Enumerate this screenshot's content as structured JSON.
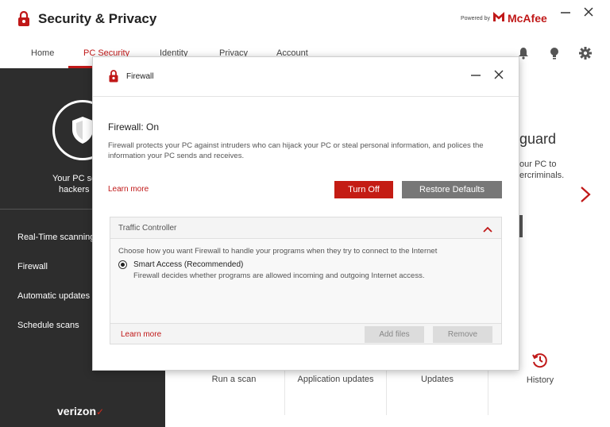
{
  "app": {
    "title": "Security & Privacy"
  },
  "branding": {
    "powered_by": "Powered by",
    "brand": "McAfee"
  },
  "nav": {
    "tabs": [
      {
        "label": "Home"
      },
      {
        "label": "PC Security"
      },
      {
        "label": "Identity"
      },
      {
        "label": "Privacy"
      },
      {
        "label": "Account"
      }
    ],
    "active_tab": "PC Security"
  },
  "sidebar": {
    "status_line1": "Your PC securit",
    "status_line2": "hackers and",
    "items": [
      {
        "label": "Real-Time scanning"
      },
      {
        "label": "Firewall"
      },
      {
        "label": "Automatic updates"
      },
      {
        "label": "Schedule scans"
      }
    ],
    "carrier_logo": "verizon"
  },
  "background": {
    "heading_fragment": "guard",
    "line1": "our PC to",
    "line2": "ercriminals.",
    "tiles": [
      {
        "label": "Run a scan"
      },
      {
        "label": "Application updates"
      },
      {
        "label": "Updates"
      },
      {
        "label": "History",
        "icon": "history-icon"
      }
    ]
  },
  "dialog": {
    "title": "Firewall",
    "status": "Firewall: On",
    "description": "Firewall protects your PC against intruders who can hijack your PC or steal personal information, and polices the information your PC sends and receives.",
    "learn_more": "Learn more",
    "turn_off_label": "Turn Off",
    "restore_label": "Restore Defaults",
    "traffic_controller": {
      "title": "Traffic Controller",
      "prompt": "Choose how you want Firewall to handle your programs when they try to connect to the Internet",
      "option_label": "Smart Access (Recommended)",
      "option_description": "Firewall decides whether programs are allowed incoming and outgoing Internet access.",
      "selected": true,
      "learn_more": "Learn more",
      "add_files_label": "Add files",
      "remove_label": "Remove"
    }
  },
  "colors": {
    "accent": "#c01818",
    "sidebar_bg": "#2d2d2d",
    "secondary_button": "#777777"
  }
}
